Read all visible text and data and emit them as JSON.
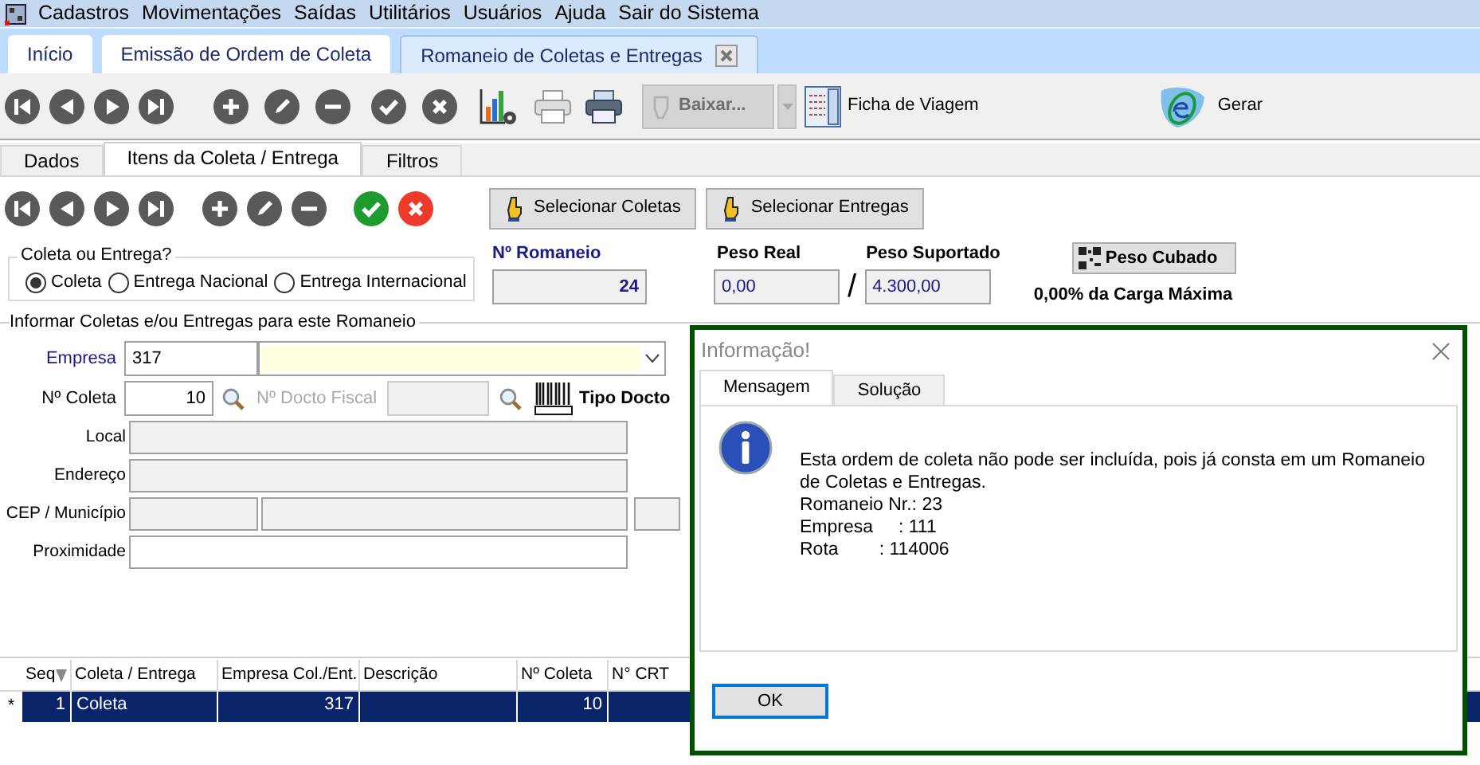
{
  "menu": [
    "Cadastros",
    "Movimentações",
    "Saídas",
    "Utilitários",
    "Usuários",
    "Ajuda",
    "Sair do Sistema"
  ],
  "tabs": [
    {
      "label": "Início",
      "selected": false,
      "closable": false
    },
    {
      "label": "Emissão de Ordem de Coleta",
      "selected": false,
      "closable": false
    },
    {
      "label": "Romaneio de Coletas e Entregas",
      "selected": true,
      "closable": true
    }
  ],
  "toolbar": {
    "baixar": {
      "label": "Baixar...",
      "disabled": true
    },
    "ficha": "Ficha de Viagem",
    "gerar": "Gerar"
  },
  "subtabs": [
    {
      "label": "Dados",
      "selected": false
    },
    {
      "label": "Itens da Coleta / Entrega",
      "selected": true
    },
    {
      "label": "Filtros",
      "selected": false
    }
  ],
  "item_toolbar": [
    "Selecionar Coletas",
    "Selecionar Entregas"
  ],
  "tipo_group": {
    "title": "Coleta ou Entrega?",
    "options": [
      {
        "label": "Coleta",
        "selected": true
      },
      {
        "label": "Entrega Nacional",
        "selected": false
      },
      {
        "label": "Entrega Internacional",
        "selected": false
      }
    ]
  },
  "romaneio": {
    "label": "Nº Romaneio",
    "value": "24"
  },
  "peso_real": {
    "label": "Peso Real",
    "value": "0,00"
  },
  "separator": "/",
  "peso_suportado": {
    "label": "Peso Suportado",
    "value": "4.300,00"
  },
  "peso_cubado_button": "Peso Cubado",
  "carga_maxima": "0,00% da Carga Máxima",
  "section_title": "Informar Coletas e/ou Entregas para este Romaneio",
  "empresa": {
    "label": "Empresa",
    "value": "317"
  },
  "coleta": {
    "label": "Nº Coleta",
    "value": "10"
  },
  "docto_fiscal": {
    "label": "Nº Docto Fiscal",
    "disabled": true
  },
  "tipo_docto": {
    "label": "Tipo Docto"
  },
  "fields": [
    {
      "label": "Local",
      "kind": "readonly"
    },
    {
      "label": "Endereço",
      "kind": "readonly"
    },
    {
      "label": "CEP / Município",
      "kind": "split"
    },
    {
      "label": "Proximidade",
      "kind": "editable"
    }
  ],
  "grid": {
    "columns": [
      "Seq",
      "Coleta / Entrega",
      "Empresa Col./Ent.",
      "Descrição",
      "Nº Coleta",
      "N° CRT"
    ],
    "rows": [
      {
        "marker": "*",
        "selected": true,
        "seq": "1",
        "tipo": "Coleta",
        "empresa": "317",
        "n_coleta": "10"
      }
    ]
  },
  "dialog": {
    "title": "Informação!",
    "tabs": [
      {
        "label": "Mensagem",
        "selected": true
      },
      {
        "label": "Solução",
        "selected": false
      }
    ],
    "message": [
      "Esta ordem de coleta não pode ser incluída, pois já consta em um Romaneio de Coletas e Entregas.",
      "Romaneio Nr.: 23",
      "Empresa     : 111",
      "Rota        : 114006"
    ],
    "button": "OK"
  }
}
